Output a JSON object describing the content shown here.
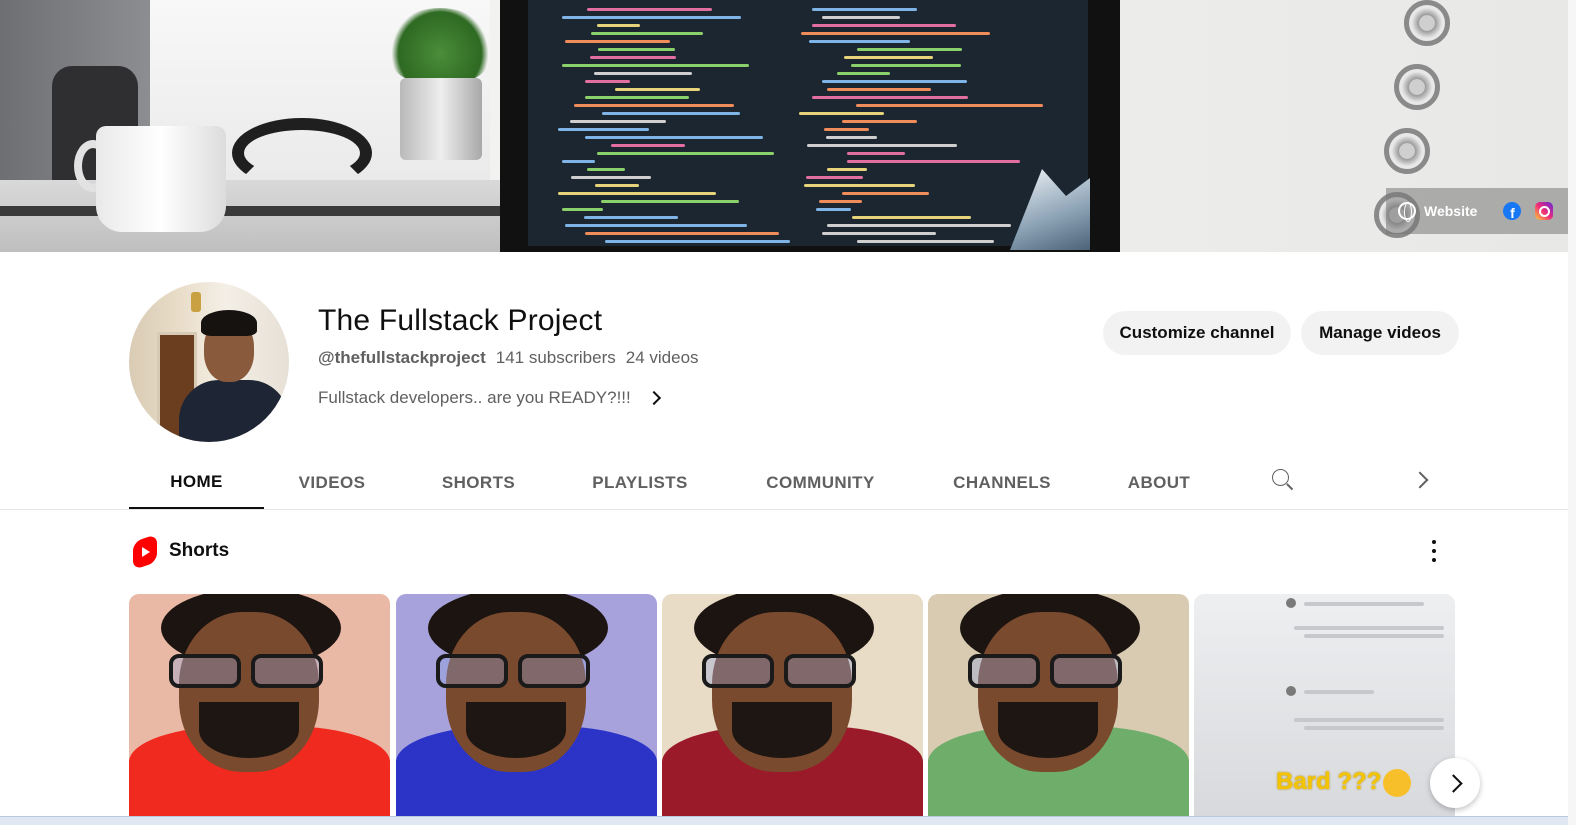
{
  "banner": {
    "links": {
      "website_label": "Website",
      "facebook_icon": "facebook-icon",
      "instagram_icon": "instagram-icon"
    }
  },
  "channel": {
    "name": "The Fullstack Project",
    "handle": "@thefullstackproject",
    "subscribers": "141 subscribers",
    "videos": "24 videos",
    "description": "Fullstack developers.. are you READY?!!!"
  },
  "actions": {
    "customize": "Customize channel",
    "manage": "Manage videos"
  },
  "tabs": [
    {
      "label": "HOME",
      "active": true
    },
    {
      "label": "VIDEOS",
      "active": false
    },
    {
      "label": "SHORTS",
      "active": false
    },
    {
      "label": "PLAYLISTS",
      "active": false
    },
    {
      "label": "COMMUNITY",
      "active": false
    },
    {
      "label": "CHANNELS",
      "active": false
    },
    {
      "label": "ABOUT",
      "active": false
    }
  ],
  "shorts": {
    "title": "Shorts",
    "items": [
      {
        "shirt_color": "#f02a1e",
        "bg_color": "#e9b9a6"
      },
      {
        "shirt_color": "#2c34c8",
        "bg_color": "#a7a2dc"
      },
      {
        "shirt_color": "#9b1a2a",
        "bg_color": "#e9dcc6"
      },
      {
        "shirt_color": "#6fae6a",
        "bg_color": "#d8cbb2"
      },
      {
        "overlay_text": "Bard ???"
      }
    ]
  },
  "colors": {
    "accent_red": "#ff0000",
    "text_primary": "#0f0f0f",
    "text_secondary": "#606060",
    "button_bg": "#f2f2f2"
  }
}
